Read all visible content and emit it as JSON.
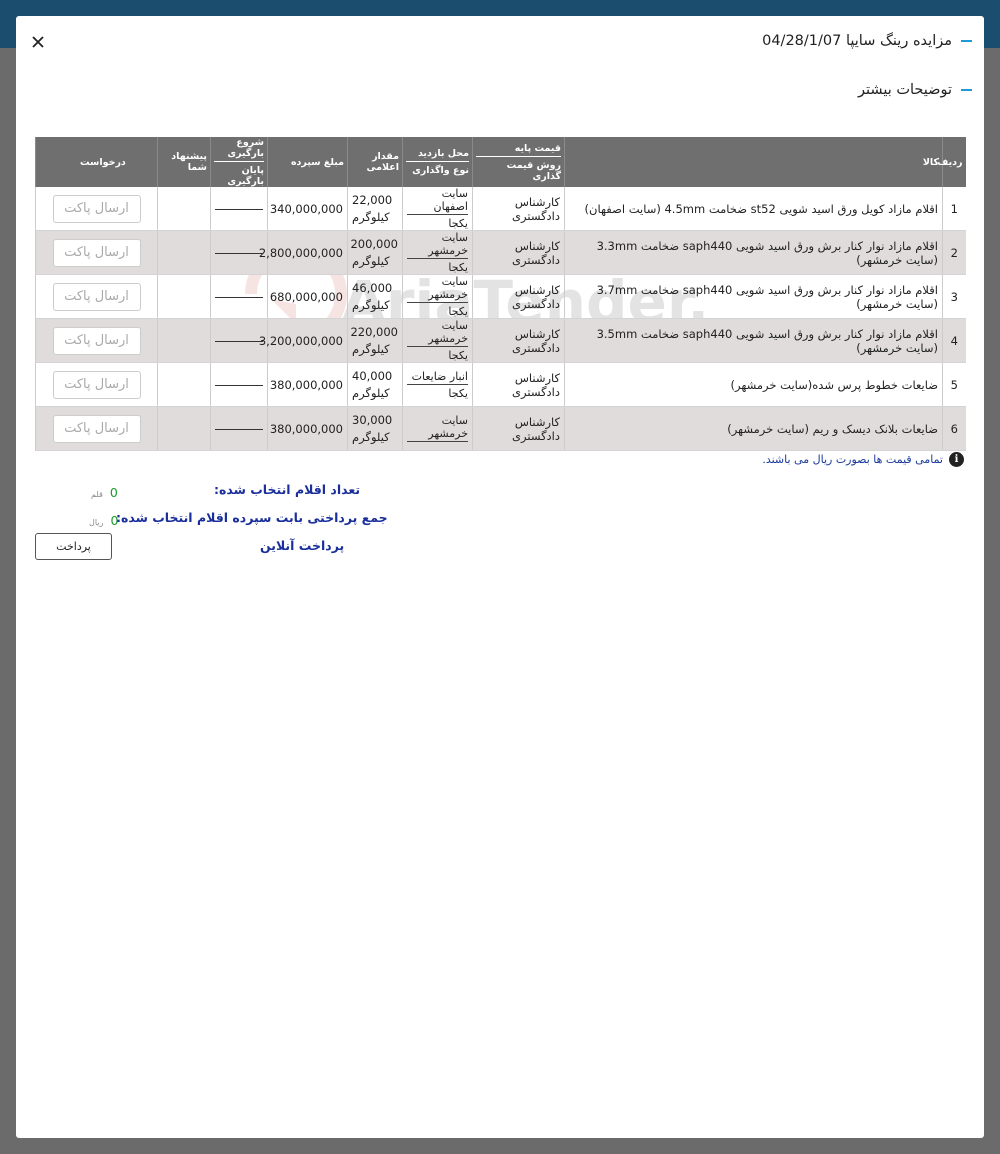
{
  "header": {
    "title": "مزایده رینگ سایپا 04/28/1/07",
    "more_info": "توضیحات بیشتر"
  },
  "table": {
    "headers": {
      "row_no": "ردیف",
      "item": "کالا",
      "base_price": "قیمت پایه",
      "pricing_method": "روش قیمت گذاری",
      "visit_place": "محل بازدید",
      "assignment_type": "نوع واگذاری",
      "quantity": "مقدار اعلامی",
      "deposit": "مبلغ سپرده",
      "load_start": "شروع بارگیری",
      "load_end": "پایان بارگیری",
      "your_offer": "پیشنهاد شما",
      "request": "درخواست"
    },
    "rows": [
      {
        "no": "1",
        "item": "اقلام مازاد کویل ورق اسید شویی st52 ضخامت 4.5mm (سایت اصفهان)",
        "pricing": "کارشناس دادگستری",
        "place": "سایت اصفهان",
        "assign": "یکجا",
        "qty": "22,000",
        "unit": "کیلوگرم",
        "deposit": "340,000,000",
        "send": "ارسال پاکت"
      },
      {
        "no": "2",
        "item": "اقلام مازاد نوار کنار برش ورق اسید شویی saph440 ضخامت 3.3mm (سایت خرمشهر)",
        "pricing": "کارشناس دادگستری",
        "place": "سایت خرمشهر",
        "assign": "یکجا",
        "qty": "200,000",
        "unit": "کیلوگرم",
        "deposit": "2,800,000,000",
        "send": "ارسال پاکت"
      },
      {
        "no": "3",
        "item": "اقلام مازاد نوار کنار برش ورق اسید شویی saph440 ضخامت 3.7mm (سایت خرمشهر)",
        "pricing": "کارشناس دادگستری",
        "place": "سایت خرمشهر",
        "assign": "یکجا",
        "qty": "46,000",
        "unit": "کیلوگرم",
        "deposit": "680,000,000",
        "send": "ارسال پاکت"
      },
      {
        "no": "4",
        "item": "اقلام مازاد نوار کنار برش ورق اسید شویی saph440 ضخامت 3.5mm (سایت خرمشهر)",
        "pricing": "کارشناس دادگستری",
        "place": "سایت خرمشهر",
        "assign": "یکجا",
        "qty": "220,000",
        "unit": "کیلوگرم",
        "deposit": "3,200,000,000",
        "send": "ارسال پاکت"
      },
      {
        "no": "5",
        "item": "ضایعات خطوط پرس شده(سایت خرمشهر)",
        "pricing": "کارشناس دادگستری",
        "place": "انبار ضایعات",
        "assign": "یکجا",
        "qty": "40,000",
        "unit": "کیلوگرم",
        "deposit": "380,000,000",
        "send": "ارسال پاکت"
      },
      {
        "no": "6",
        "item": "ضایعات بلانک دیسک و ریم (سایت خرمشهر)",
        "pricing": "کارشناس دادگستری",
        "place": "سایت خرمشهر",
        "assign": "",
        "qty": "30,000",
        "unit": "کیلوگرم",
        "deposit": "380,000,000",
        "send": "ارسال پاکت"
      }
    ]
  },
  "note": "تمامی قیمت ها بصورت ریال می باشند.",
  "summary": {
    "count_label": "تعداد اقلام انتخاب شده:",
    "count_value": "0",
    "count_unit": "قلم",
    "total_label": "جمع پرداختی بابت سپرده اقلام انتخاب شده:",
    "total_value": "0",
    "total_unit": "ریال",
    "online_label": "پرداخت آنلاین",
    "pay_button": "پرداخت"
  },
  "watermark": "AriaTender.neT",
  "colors": {
    "topbar": "#1b4e6e",
    "accent": "#1e9bd7",
    "table_header": "#6f6f6f",
    "label_blue": "#1a2f9c",
    "value_green": "#1a9c2b"
  }
}
